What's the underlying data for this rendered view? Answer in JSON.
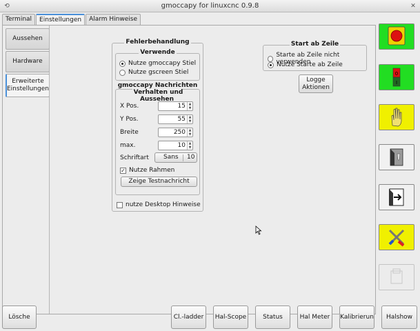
{
  "window": {
    "title": "gmoccapy for linuxcnc 0.9.8"
  },
  "tabs": [
    {
      "label": "Terminal"
    },
    {
      "label": "Einstellungen"
    },
    {
      "label": "Alarm Hinweise"
    }
  ],
  "vtabs": [
    {
      "label": "Aussehen"
    },
    {
      "label": "Hardware"
    },
    {
      "label": "Erweiterte Einstellungen"
    }
  ],
  "error_frame": {
    "title": "Fehlerbehandlung",
    "subtitle": "Verwende",
    "opt1": "Nutze gmoccapy Stiel",
    "opt2": "Nutze gscreen Stiel"
  },
  "msg_frame": {
    "title_line1": "gmoccapy Nachrichten",
    "title_line2": "Verhalten und Aussehen",
    "x_label": "X Pos.",
    "x_val": "15",
    "y_label": "Y Pos.",
    "y_val": "55",
    "w_label": "Breite",
    "w_val": "250",
    "max_label": "max.",
    "max_val": "10",
    "font_label": "Schriftart",
    "font_name": "Sans",
    "font_size": "10",
    "frame_check": "Nutze Rahmen",
    "test_button": "Zeige Testnachricht"
  },
  "desktop_check": "nutze Desktop Hinweise",
  "start_frame": {
    "title": "Start ab Zeile",
    "opt1": "Starte ab Zeile nicht verwenden",
    "opt2": "Nutze Starte ab Zeile"
  },
  "log_button": {
    "line1": "Logge",
    "line2": "Aktionen"
  },
  "bottom": {
    "b1": "Lösche MDI",
    "b2": "Cl.-ladder",
    "b3": "Hal-Scope",
    "b4": "Status",
    "b5": "Hal Meter",
    "b6": "Kalibrierun",
    "b7": "Halshow"
  },
  "side_icons": [
    "estop-icon",
    "machine-power-icon",
    "manual-mode-icon",
    "mdi-mode-icon",
    "auto-mode-icon",
    "settings-icon",
    "user-tabs-icon"
  ],
  "colors": {
    "green": "#22dd22",
    "yellow": "#f0f000",
    "red": "#dd1111"
  }
}
